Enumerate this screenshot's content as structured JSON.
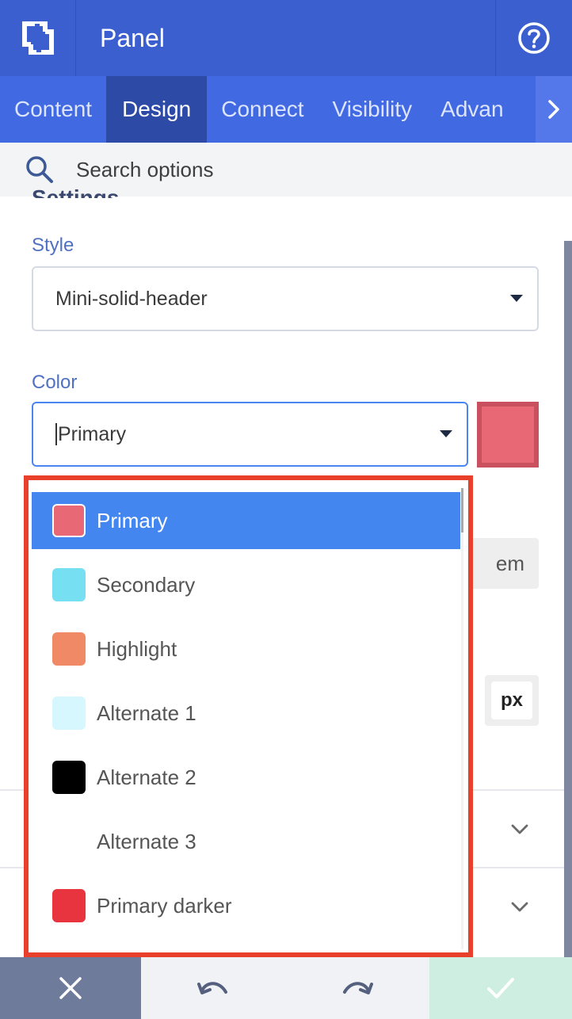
{
  "header": {
    "title": "Panel",
    "logo_icon": "logo-icon",
    "help_icon": "help-circle-icon"
  },
  "tabs": [
    {
      "label": "Content"
    },
    {
      "label": "Design"
    },
    {
      "label": "Connect"
    },
    {
      "label": "Visibility"
    },
    {
      "label": "Advan"
    }
  ],
  "search": {
    "placeholder": "Search options"
  },
  "section": {
    "partial_heading": "Settings"
  },
  "style_field": {
    "label": "Style",
    "value": "Mini-solid-header"
  },
  "color_field": {
    "label": "Color",
    "value": "Primary",
    "swatch_color": "#e86876"
  },
  "units": {
    "em": "em",
    "px": "px"
  },
  "color_menu": {
    "items": [
      {
        "label": "Primary",
        "color": "#e86876"
      },
      {
        "label": "Secondary",
        "color": "#76dff2"
      },
      {
        "label": "Highlight",
        "color": "#f08a66"
      },
      {
        "label": "Alternate 1",
        "color": "#d6f7fd"
      },
      {
        "label": "Alternate 2",
        "color": "#000000"
      },
      {
        "label": "Alternate 3",
        "color": ""
      },
      {
        "label": "Primary darker",
        "color": "#e8343e"
      }
    ]
  },
  "colors": {
    "header": "#3b5fcf",
    "tabs": "#4169e1",
    "active_tab": "#2d4aa6",
    "menu_highlight": "#4486ef",
    "menu_outline": "#e8402a"
  }
}
